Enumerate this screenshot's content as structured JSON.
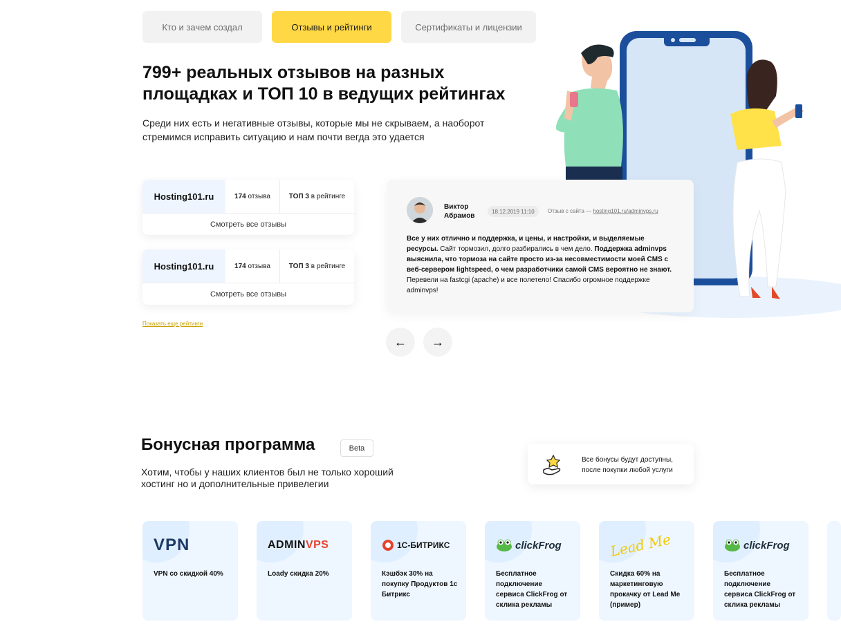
{
  "tabs": [
    {
      "label": "Кто и зачем создал"
    },
    {
      "label": "Отзывы и рейтинги"
    },
    {
      "label": "Сертификаты и лицензии"
    }
  ],
  "headline": "799+ реальных отзывов на разных площадках и ТОП 10 в ведущих рейтингах",
  "lead": "Среди них есть и негативные отзывы, которые мы не скрываем, а наоборот стремимся исправить ситуацию и нам почти вегда это удается",
  "ratings": [
    {
      "site": "Hosting101.ru",
      "count_num": "174",
      "count_word": "отзыва",
      "top": "ТОП 3",
      "top_suffix": "в рейтинге",
      "all_label": "Смотреть все отзывы"
    },
    {
      "site": "Hosting101.ru",
      "count_num": "174",
      "count_word": "отзыва",
      "top": "ТОП 3",
      "top_suffix": "в рейтинге",
      "all_label": "Смотреть все отзывы"
    }
  ],
  "more_ratings_link": "Показать еще рейтинги",
  "review": {
    "author": "Виктор Абрамов",
    "date": "18.12.2019 11:10",
    "source_prefix": "Отзыв с сайта —",
    "source_link": "hosting101.ru/adminvps.ru",
    "text_parts": [
      {
        "bold": true,
        "text": "Все у них отлично и поддержка, и цены, и настройки, и выделяемые ресурсы."
      },
      {
        "bold": false,
        "text": " Сайт тормозил, долго разбирались в чем дело. "
      },
      {
        "bold": true,
        "text": "Поддержка adminvps выяснила, что тормоза на сайте просто из-за несовместимости моей CMS с веб-сервером lightspeed, о чем разработчики самой CMS вероятно не знают."
      },
      {
        "bold": false,
        "text": " Перевели на fastcgi (apache) и все полетело!  Спасибо огромное поддержке adminvps!"
      }
    ]
  },
  "nav": {
    "prev_icon": "arrow-left-icon",
    "next_icon": "arrow-right-icon",
    "prev_glyph": "←",
    "next_glyph": "→"
  },
  "bonus": {
    "title": "Бонусная программа",
    "beta": "Beta",
    "lead": "Хотим, чтобы у наших клиентов был не только хороший хостинг но и дополнительные привелегии",
    "notice": "Все бонусы будут доступны, после покупки любой услуги",
    "cards": [
      {
        "logo": "VPN",
        "desc": "VPN со скидкой 40%"
      },
      {
        "logo_a": "ADMIN",
        "logo_b": "VPS",
        "desc": "Loady скидка 20%"
      },
      {
        "logo": "1С-БИТРИКС",
        "desc": "Кэшбэк 30% на покупку Продуктов 1с Битрикс"
      },
      {
        "logo": "clickFrog",
        "desc": "Бесплатное подключение сервиса ClickFrog от склика рекламы"
      },
      {
        "logo": "Lead Me",
        "desc": "Скидка 60% на маркетинговую прокачку от Lead Me (пример)"
      },
      {
        "logo": "clickFrog",
        "desc": "Бесплатное подключение сервиса ClickFrog от склика рекламы"
      }
    ]
  },
  "colors": {
    "accent": "#ffd845",
    "card_bg": "#eef6ff",
    "link": "#c9a100"
  }
}
